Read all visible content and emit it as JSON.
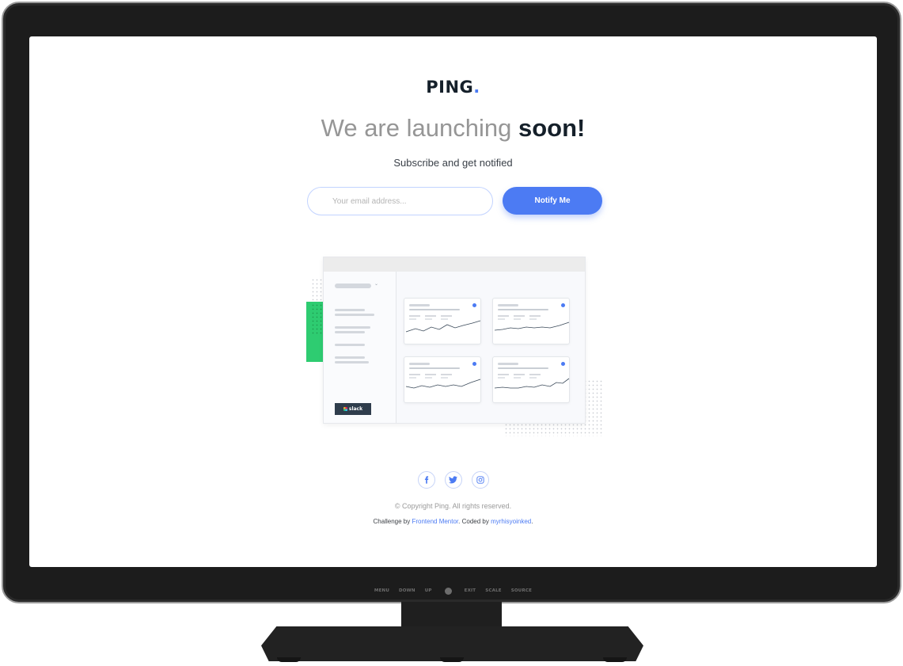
{
  "brand": {
    "name": "PING",
    "dot": "."
  },
  "headline": {
    "light": "We are launching",
    "bold": "soon!"
  },
  "subtitle": "Subscribe and get notified",
  "form": {
    "email_placeholder": "Your email address...",
    "email_value": "",
    "button_label": "Notify Me"
  },
  "illustration": {
    "slack_label": "slack"
  },
  "socials": [
    {
      "icon": "facebook-icon"
    },
    {
      "icon": "twitter-icon"
    },
    {
      "icon": "instagram-icon"
    }
  ],
  "footer": {
    "copyright": "© Copyright Ping. All rights reserved.",
    "challenge_prefix": "Challenge by",
    "challenge_link": "Frontend Mentor",
    "coded_prefix": ". Coded by",
    "coded_link": "myrhisyoinked",
    "end": "."
  },
  "monitor": {
    "controls": [
      "MENU",
      "DOWN",
      "UP",
      "EXIT",
      "SCALE",
      "SOURCE"
    ]
  },
  "colors": {
    "accent": "#4c7bf3",
    "dark": "#15202a",
    "green": "#2ecc71"
  }
}
